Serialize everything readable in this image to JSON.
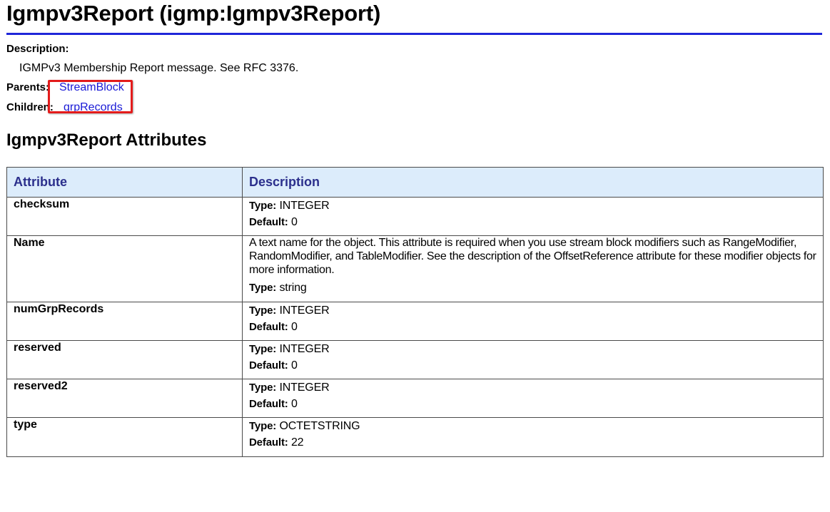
{
  "title": "Igmpv3Report (igmp:Igmpv3Report)",
  "description_label": "Description:",
  "description_text": "IGMPv3 Membership Report message. See RFC 3376.",
  "parents_label": "Parents:",
  "parents_link": "StreamBlock",
  "children_label": "Children:",
  "children_link": "grpRecords",
  "section_title": "Igmpv3Report Attributes",
  "colors": {
    "title_rule": "#1f26d9",
    "header_bg": "#dcecfb",
    "header_text": "#2b2f8c",
    "link": "#1a1ad6",
    "highlight_box": "#e31b1b"
  },
  "table": {
    "headers": [
      "Attribute",
      "Description"
    ],
    "type_label": "Type:",
    "default_label": "Default:",
    "rows": [
      {
        "name": "checksum",
        "type": "INTEGER",
        "default": "0"
      },
      {
        "name": "Name",
        "text": "A text name for the object. This attribute is required when you use stream block modifiers such as RangeModifier, RandomModifier, and TableModifier. See the description of the OffsetReference attribute for these modifier objects for more information.",
        "type": "string"
      },
      {
        "name": "numGrpRecords",
        "type": "INTEGER",
        "default": "0"
      },
      {
        "name": "reserved",
        "type": "INTEGER",
        "default": "0"
      },
      {
        "name": "reserved2",
        "type": "INTEGER",
        "default": "0"
      },
      {
        "name": "type",
        "type": "OCTETSTRING",
        "default": "22"
      }
    ]
  }
}
